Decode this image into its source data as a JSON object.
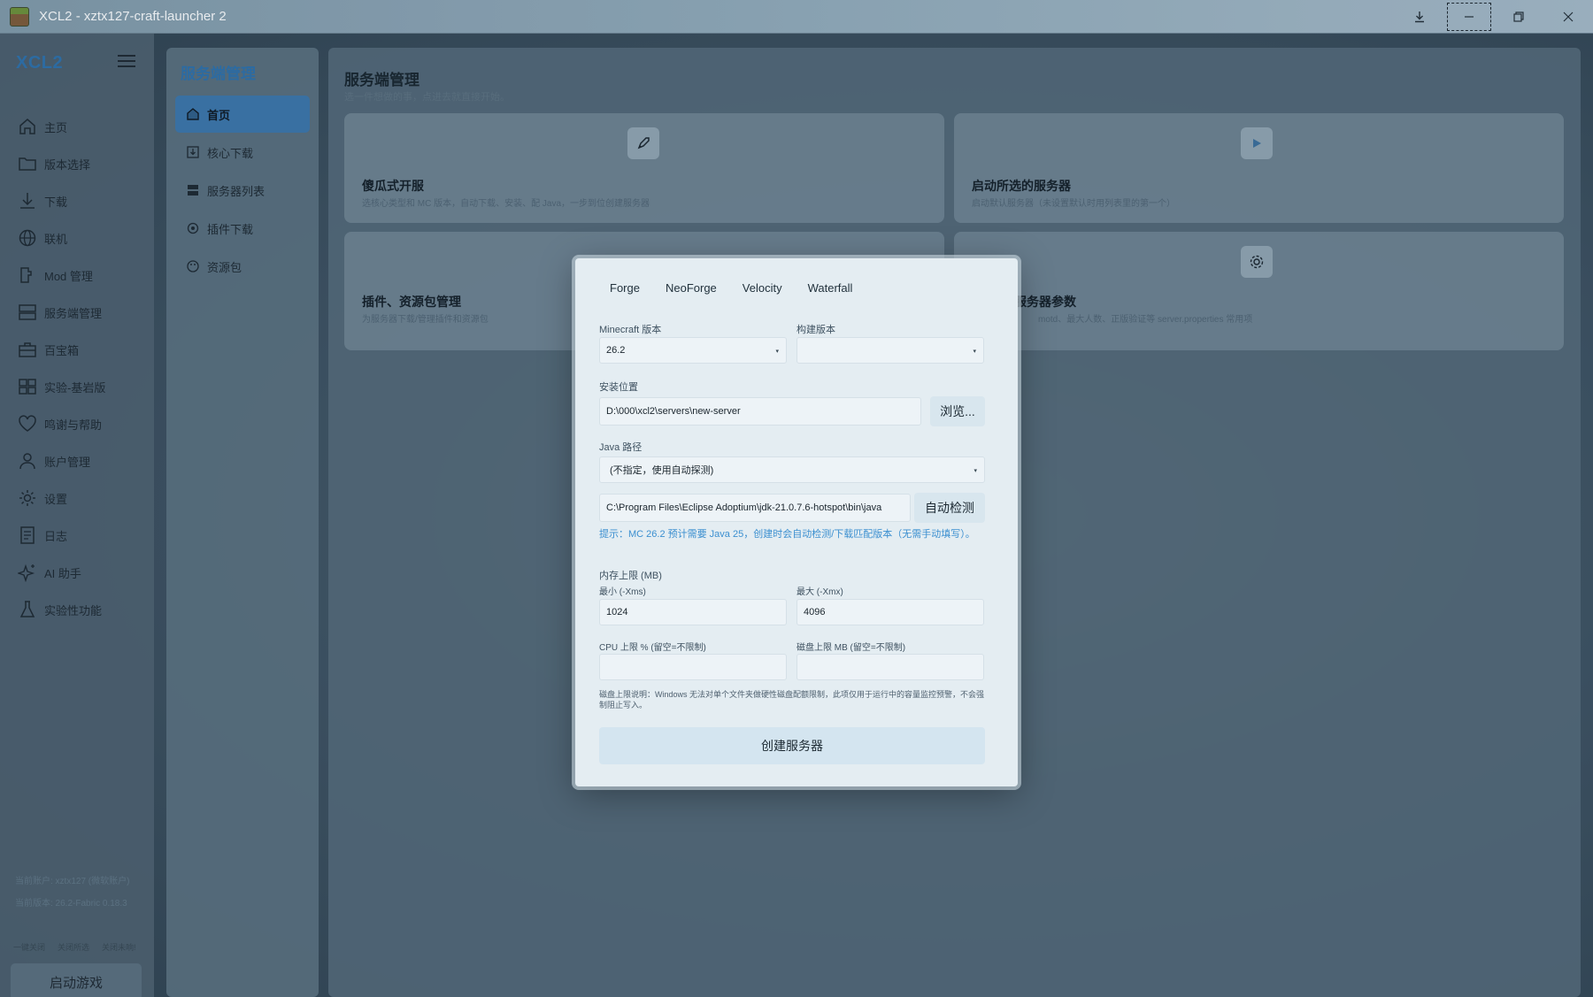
{
  "window": {
    "title": "XCL2 - xztx127-craft-launcher 2",
    "controls": [
      "download",
      "minimize",
      "maximize",
      "close"
    ]
  },
  "sidebar": {
    "brand": "XCL2",
    "items": [
      {
        "label": "主页",
        "icon": "home-icon"
      },
      {
        "label": "版本选择",
        "icon": "folder-icon"
      },
      {
        "label": "下载",
        "icon": "download-icon"
      },
      {
        "label": "联机",
        "icon": "globe-icon"
      },
      {
        "label": "Mod 管理",
        "icon": "puzzle-icon"
      },
      {
        "label": "服务端管理",
        "icon": "server-icon"
      },
      {
        "label": "百宝箱",
        "icon": "toolbox-icon"
      },
      {
        "label": "实验-基岩版",
        "icon": "grid-icon"
      },
      {
        "label": "鸣谢与帮助",
        "icon": "heart-icon"
      },
      {
        "label": "账户管理",
        "icon": "user-icon"
      },
      {
        "label": "设置",
        "icon": "gear-icon"
      },
      {
        "label": "日志",
        "icon": "document-icon"
      },
      {
        "label": "AI 助手",
        "icon": "sparkle-icon"
      },
      {
        "label": "实验性功能",
        "icon": "flask-icon"
      }
    ],
    "account_info": "当前账户: xztx127 (微软账户)",
    "version_info": "当前版本: 26.2-Fabric 0.18.3",
    "quick_actions": [
      "一键关闭",
      "关闭所选",
      "关闭未响!"
    ],
    "start_button": "启动游戏"
  },
  "subnav": {
    "title": "服务端管理",
    "items": [
      {
        "label": "首页",
        "icon": "home-icon",
        "active": true
      },
      {
        "label": "核心下载",
        "icon": "download-box-icon",
        "active": false
      },
      {
        "label": "服务器列表",
        "icon": "server-list-icon",
        "active": false
      },
      {
        "label": "插件下载",
        "icon": "plugin-icon",
        "active": false
      },
      {
        "label": "资源包",
        "icon": "palette-icon",
        "active": false
      }
    ]
  },
  "main": {
    "title": "服务端管理",
    "subtitle": "选一件想做的事，点进去就直接开始。",
    "cards": [
      {
        "title": "傻瓜式开服",
        "desc": "选核心类型和 MC 版本，自动下载、安装、配 Java，一步到位创建服务器",
        "icon": "rocket-icon"
      },
      {
        "title": "启动所选的服务器",
        "desc": "启动默认服务器（未设置默认时用列表里的第一个）",
        "icon": "play-icon"
      },
      {
        "title": "插件、资源包管理",
        "desc": "为服务器下载/管理插件和资源包",
        "icon": "puzzle-icon"
      },
      {
        "title": "中的服务器参数",
        "desc": "motd、最大人数、正版验证等 server.properties 常用项",
        "icon": "gear-icon"
      }
    ]
  },
  "dialog": {
    "tabs": [
      "Forge",
      "NeoForge",
      "Velocity",
      "Waterfall"
    ],
    "mc_version_label": "Minecraft 版本",
    "mc_version_value": "26.2",
    "build_version_label": "构建版本",
    "build_version_value": "",
    "install_location_label": "安装位置",
    "install_location_value": "D:\\000\\xcl2\\servers\\new-server",
    "browse_button": "浏览...",
    "java_path_label": "Java 路径",
    "java_select_value": "(不指定，使用自动探测)",
    "java_path_value": "C:\\Program Files\\Eclipse Adoptium\\jdk-21.0.7.6-hotspot\\bin\\java",
    "auto_detect_button": "自动检测",
    "hint": "提示：MC 26.2 预计需要 Java 25，创建时会自动检测/下载匹配版本（无需手动填写）。",
    "memory_label": "内存上限 (MB)",
    "min_label": "最小 (-Xms)",
    "min_value": "1024",
    "max_label": "最大 (-Xmx)",
    "max_value": "4096",
    "cpu_label": "CPU 上限 % (留空=不限制)",
    "cpu_value": "",
    "disk_label": "磁盘上限 MB (留空=不限制)",
    "disk_value": "",
    "disk_note": "磁盘上限说明：Windows 无法对单个文件夹做硬性磁盘配额限制，此项仅用于运行中的容量监控预警，不会强制阻止写入。",
    "create_button": "创建服务器"
  }
}
